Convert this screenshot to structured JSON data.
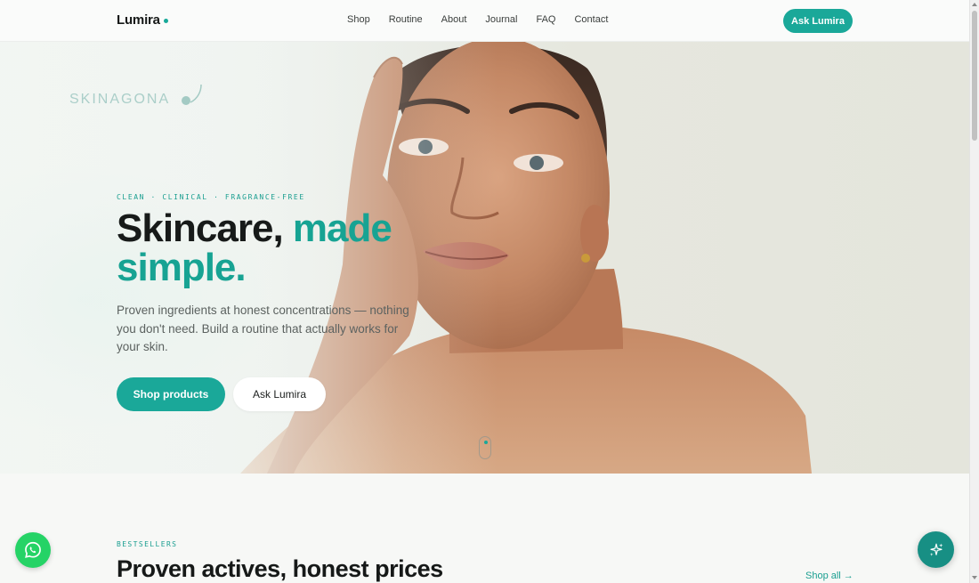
{
  "header": {
    "brand": "Lumira",
    "nav": [
      "Shop",
      "Routine",
      "About",
      "Journal",
      "FAQ",
      "Contact"
    ],
    "cta_label": "Ask Lumira"
  },
  "hero": {
    "watermark": "SKINAGONA",
    "eyebrow": "CLEAN · CLINICAL · FRAGRANCE-FREE",
    "headline_main": "Skincare, ",
    "headline_accent": "made simple.",
    "subcopy": "Proven ingredients at honest concentrations — nothing you don't need. Build a routine that actually works for your skin.",
    "primary_button": "Shop products",
    "secondary_button": "Ask Lumira"
  },
  "bestsellers": {
    "eyebrow": "BESTSELLERS",
    "title": "Proven actives, honest prices",
    "shop_all": "Shop all →"
  },
  "icons": {
    "brand_dot": "dot-icon",
    "whatsapp": "whatsapp-icon",
    "assistant": "sparkle-icon",
    "scroll": "mouse-scroll-icon"
  },
  "colors": {
    "accent": "#1aa899",
    "accent_dark": "#178f84",
    "whatsapp": "#25d366",
    "text": "#171a19",
    "muted": "#5c6260"
  }
}
